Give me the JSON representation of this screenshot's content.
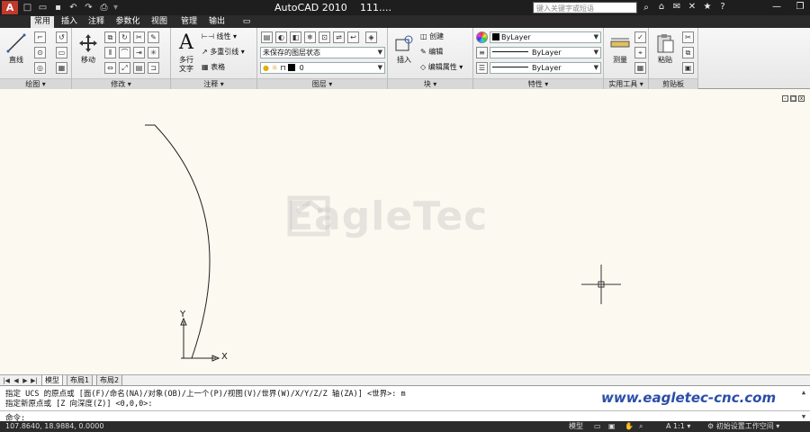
{
  "titlebar": {
    "app_letter": "A",
    "app_name": "AutoCAD 2010",
    "file_name": "111....",
    "search_placeholder": "键入关键字或短语",
    "qat_icons": [
      "new-icon",
      "open-icon",
      "save-icon",
      "undo-icon",
      "redo-icon",
      "plot-icon"
    ]
  },
  "tabs": [
    {
      "label": "常用",
      "active": true
    },
    {
      "label": "插入"
    },
    {
      "label": "注释"
    },
    {
      "label": "参数化"
    },
    {
      "label": "视图"
    },
    {
      "label": "管理"
    },
    {
      "label": "输出"
    }
  ],
  "ribbon": {
    "draw": {
      "label": "绘图",
      "line": "直线"
    },
    "modify": {
      "label": "修改",
      "move": "移动"
    },
    "annotation": {
      "label": "注释",
      "mtext_1": "多行",
      "mtext_2": "文字",
      "linear": "线性",
      "mleader": "多重引线",
      "table": "表格"
    },
    "layers": {
      "label": "图层",
      "state": "未保存的图层状态",
      "current_layer": "0"
    },
    "block": {
      "label": "块",
      "insert": "插入",
      "create": "创建",
      "edit": "编辑",
      "edit_attr": "编辑属性"
    },
    "properties": {
      "label": "特性",
      "color": "ByLayer",
      "linetype": "ByLayer",
      "lineweight": "ByLayer"
    },
    "utilities": {
      "label": "实用工具",
      "measure": "测量"
    },
    "clipboard": {
      "label": "剪贴板",
      "paste": "粘贴"
    }
  },
  "canvas": {
    "watermark": "EagleTec",
    "ucs_y": "Y",
    "ucs_x": "X"
  },
  "layout_tabs": [
    "模型",
    "布局1",
    "布局2"
  ],
  "command": {
    "history_1": "指定 UCS 的原点或 [面(F)/命名(NA)/对象(OB)/上一个(P)/视图(V)/世界(W)/X/Y/Z/Z 轴(ZA)] <世界>: m",
    "history_2": "指定新原点或 [Z 向深度(Z)] <0,0,0>:",
    "prompt": "命令:",
    "url": "www.eagletec-cnc.com"
  },
  "statusbar": {
    "coords": "107.8640, 18.9884, 0.0000",
    "model": "模型",
    "scale": "1:1",
    "workspace": "初始设置工作空间"
  }
}
